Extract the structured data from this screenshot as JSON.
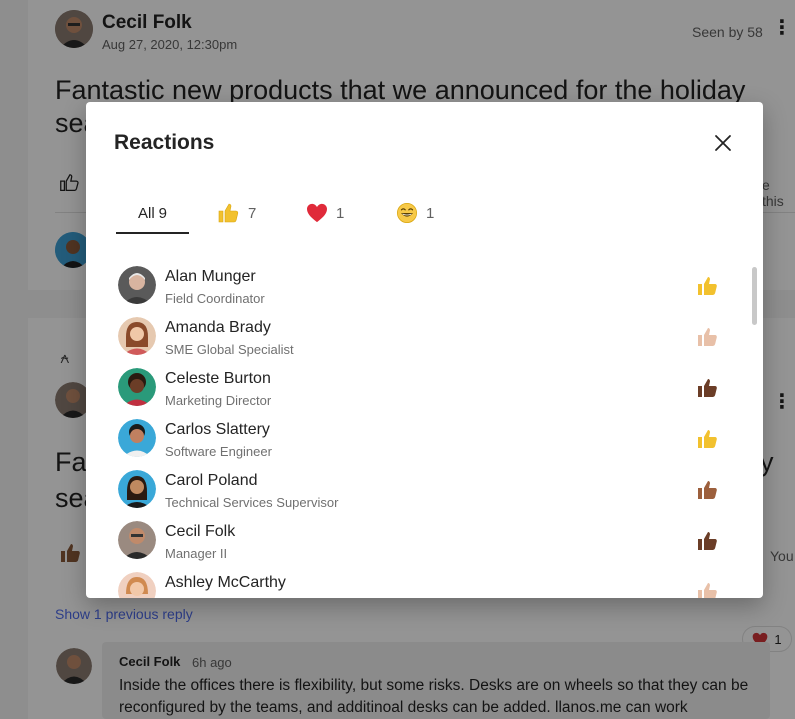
{
  "post": {
    "author": "Cecil Folk",
    "date": "Aug 27, 2020, 12:30pm",
    "seen": "Seen by 58",
    "headline": "Fantastic new products that we announced for the holiday",
    "headline_line2_frag": "sea",
    "right_frag": "e this"
  },
  "post2": {
    "headline_frag1": "Fa",
    "headline_frag2": "sea",
    "right_frag_y": "y",
    "right_frag_you": "You"
  },
  "reply_section": {
    "show_previous": "Show 1 previous reply",
    "reply_author": "Cecil Folk",
    "reply_time": "6h ago",
    "reply_text": "Inside the offices there is flexibility, but some risks. Desks are on wheels so that they can be reconfigured by the teams, and additinoal desks can be added. llanos.me can work",
    "heart_count": "1"
  },
  "modal": {
    "title": "Reactions",
    "tabs": [
      {
        "label": "All",
        "count": "9"
      },
      {
        "icon": "thumbs-up-icon",
        "count": "7"
      },
      {
        "icon": "heart-icon",
        "count": "1"
      },
      {
        "icon": "laugh-icon",
        "count": "1"
      }
    ],
    "people": [
      {
        "name": "Alan Munger",
        "title": "Field Coordinator",
        "reaction": "thumbs-up",
        "tone": "#f2c12e"
      },
      {
        "name": "Amanda Brady",
        "title": "SME Global Specialist",
        "reaction": "thumbs-up",
        "tone": "#e8c0a8"
      },
      {
        "name": "Celeste Burton",
        "title": "Marketing Director",
        "reaction": "thumbs-up",
        "tone": "#6b3d27"
      },
      {
        "name": "Carlos Slattery",
        "title": "Software Engineer",
        "reaction": "thumbs-up",
        "tone": "#f2c12e"
      },
      {
        "name": "Carol Poland",
        "title": "Technical Services Supervisor",
        "reaction": "thumbs-up",
        "tone": "#9c5f3c"
      },
      {
        "name": "Cecil Folk",
        "title": "Manager II",
        "reaction": "thumbs-up",
        "tone": "#6b3d27"
      },
      {
        "name": "Ashley McCarthy",
        "title": "",
        "reaction": "thumbs-up",
        "tone": "#e8c0a8"
      }
    ]
  }
}
